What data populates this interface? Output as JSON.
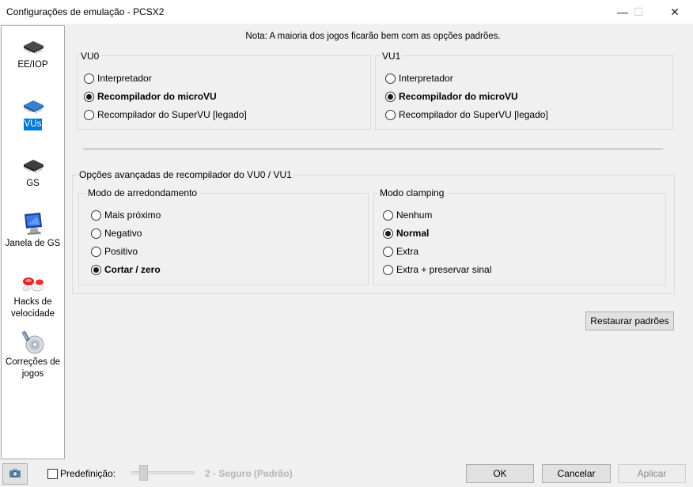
{
  "window": {
    "title": "Configurações de emulação - PCSX2",
    "minimize_glyph": "—",
    "maximize_glyph": "☐",
    "close_glyph": "✕"
  },
  "sidebar": {
    "items": [
      {
        "label": "EE/IOP",
        "icon": "chip-icon",
        "selected": false
      },
      {
        "label": "VUs",
        "icon": "vu-chip-icon",
        "selected": true
      },
      {
        "label": "GS",
        "icon": "gs-chip-icon",
        "selected": false
      },
      {
        "label": "Janela de GS",
        "icon": "monitor-icon",
        "selected": false
      },
      {
        "label": "Hacks de velocidade",
        "icon": "pills-icon",
        "selected": false
      },
      {
        "label": "Correções de jogos",
        "icon": "disc-icon",
        "selected": false
      }
    ]
  },
  "main": {
    "note": "Nota: A maioria dos jogos ficarão bem com as opções padrões.",
    "vu0": {
      "title": "VU0",
      "options": [
        "Interpretador",
        "Recompilador do microVU",
        "Recompilador do SuperVU [legado]"
      ],
      "selected": 1
    },
    "vu1": {
      "title": "VU1",
      "options": [
        "Interpretador",
        "Recompilador do microVU",
        "Recompilador do SuperVU [legado]"
      ],
      "selected": 1
    },
    "advanced": {
      "title": "Opções avançadas de recompilador do VU0 / VU1",
      "rounding": {
        "title": "Modo de arredondamento",
        "options": [
          "Mais próximo",
          "Negativo",
          "Positivo",
          "Cortar / zero"
        ],
        "selected": 3
      },
      "clamping": {
        "title": "Modo clamping",
        "options": [
          "Nenhum",
          "Normal",
          "Extra",
          "Extra + preservar sinal"
        ],
        "selected": 1
      }
    },
    "restore_defaults": "Restaurar padrões"
  },
  "footer": {
    "preset_label": "Predefinição:",
    "preset_checked": false,
    "preset_value": "2 - Seguro (Padrão)",
    "ok": "OK",
    "cancel": "Cancelar",
    "apply": "Aplicar"
  }
}
